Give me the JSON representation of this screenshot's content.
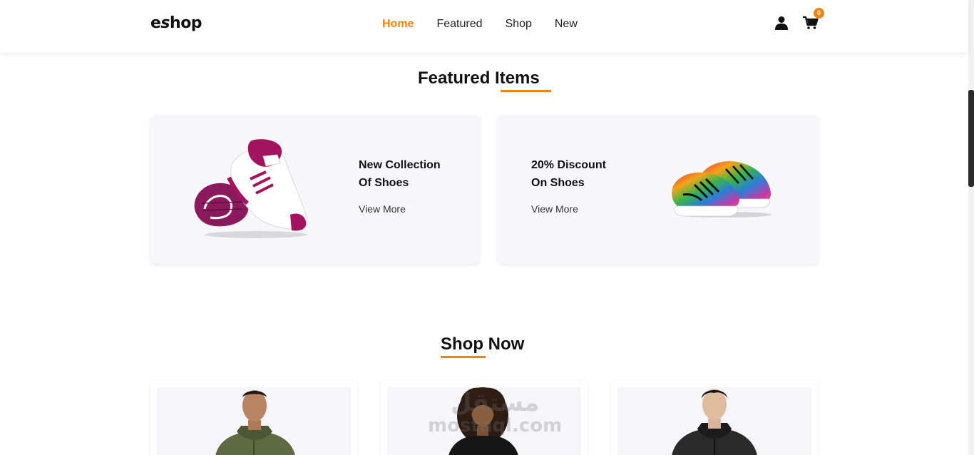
{
  "header": {
    "logo_prefix": "e",
    "logo_mark": "s",
    "logo_suffix": "hop",
    "nav": [
      "Home",
      "Featured",
      "Shop",
      "New"
    ],
    "active_nav": "Home",
    "cart_count": "0",
    "icons": [
      "user-icon",
      "cart-icon"
    ]
  },
  "featured": {
    "title_a": "Featured",
    "title_b": "Items",
    "cards": [
      {
        "line1": "New Collection",
        "line2": "Of Shoes",
        "link": "View More",
        "image": "pink-sneaker"
      },
      {
        "line1": "20% Discount",
        "line2": "On Shoes",
        "link": "View More",
        "image": "colorful-sneaker"
      }
    ]
  },
  "shop": {
    "title_a": "Shop",
    "title_b": "Now",
    "products": [
      {
        "image": "man-green-hoodie"
      },
      {
        "image": "woman-black-jacket"
      },
      {
        "image": "man-black-hoodie"
      }
    ]
  },
  "watermark": {
    "arabic": "مستقل",
    "latin": "mostaql.com"
  },
  "colors": {
    "accent": "#f5820f",
    "card_bg": "#f7f6fa",
    "text": "#111111"
  }
}
